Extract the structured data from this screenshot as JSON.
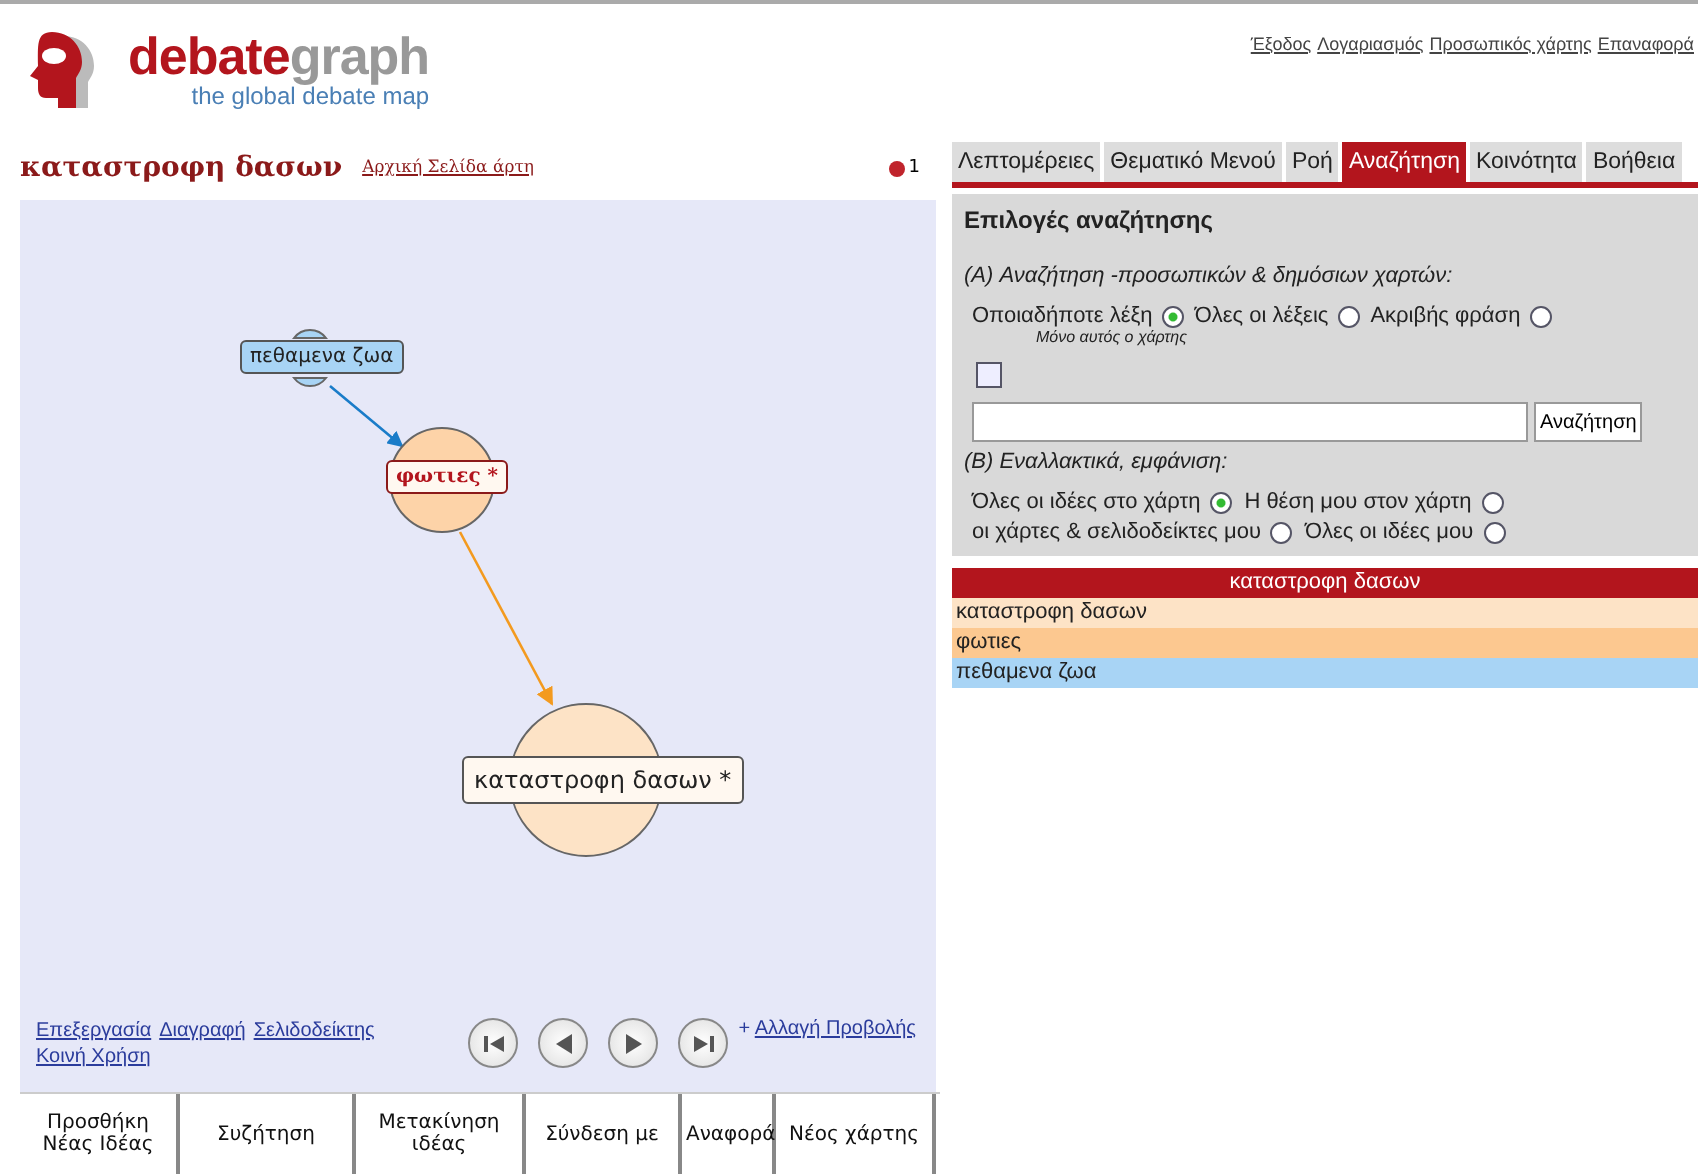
{
  "logo": {
    "parts": [
      "debate",
      "graph"
    ],
    "tagline": "the global debate map"
  },
  "top_links": [
    "Έξοδος",
    "Λογαριασμός",
    "Προσωπικός χάρτης",
    "Επαναφορά"
  ],
  "map_title": "καταστροφη δασων",
  "home_link": "Αρχική Σελίδα άρτη",
  "pin_count": "1",
  "nodes": [
    {
      "label": "πεθαμενα ζωα",
      "color": "#a8d4f5"
    },
    {
      "label": "φωτιες *",
      "color": "#fdd3a8"
    },
    {
      "label": "καταστροφη δασων *",
      "color": "#fde3c6"
    }
  ],
  "map_links": [
    "Επεξεργασία",
    "Διαγραφή",
    "Σελιδοδείκτης",
    "Κοινή Χρήση"
  ],
  "view_link": {
    "prefix": "+",
    "label": "Αλλαγή Προβολής"
  },
  "toolbar": [
    "Προσθήκη Νέας Ιδέας",
    "Συζήτηση",
    "Μετακίνηση ιδέας",
    "Σύνδεση με",
    "Αναφορά",
    "Νέος χάρτης"
  ],
  "tabs": [
    {
      "label": "Λεπτομέρειες",
      "selected": false
    },
    {
      "label": "Θεματικό Μενού",
      "selected": false
    },
    {
      "label": "Ροή",
      "selected": false
    },
    {
      "label": "Αναζήτηση",
      "selected": true
    },
    {
      "label": "Κοινότητα",
      "selected": false
    },
    {
      "label": "Βοήθεια",
      "selected": false
    }
  ],
  "search": {
    "heading": "Επιλογές αναζήτησης",
    "section_a": "(A) Αναζήτηση -προσωπικών & δημόσιων χαρτών:",
    "options_a": [
      {
        "label": "Οποιαδήποτε λέξη",
        "selected": true
      },
      {
        "label": "Όλες οι λέξεις",
        "selected": false
      },
      {
        "label": "Ακριβής φράση",
        "selected": false
      }
    ],
    "only_this_map": {
      "label": "Μόνο αυτός ο χάρτης",
      "checked": false
    },
    "button": "Αναζήτηση",
    "section_b": "(B) Εναλλακτικά, εμφάνιση:",
    "options_b": [
      {
        "label": "Όλες οι ιδέες στο χάρτη",
        "selected": true
      },
      {
        "label": "Η θέση μου στον χάρτη",
        "selected": false
      },
      {
        "label": "οι χάρτες & σελιδοδείκτες μου",
        "selected": false
      },
      {
        "label": "Όλες οι ιδέες μου",
        "selected": false
      }
    ]
  },
  "results": {
    "header": "καταστροφη δασων",
    "rows": [
      {
        "label": "καταστροφη δασων",
        "color": "#fde3c6"
      },
      {
        "label": "φωτιες",
        "color": "#fcc890"
      },
      {
        "label": "πεθαμενα ζωα",
        "color": "#a8d4f5"
      }
    ]
  }
}
